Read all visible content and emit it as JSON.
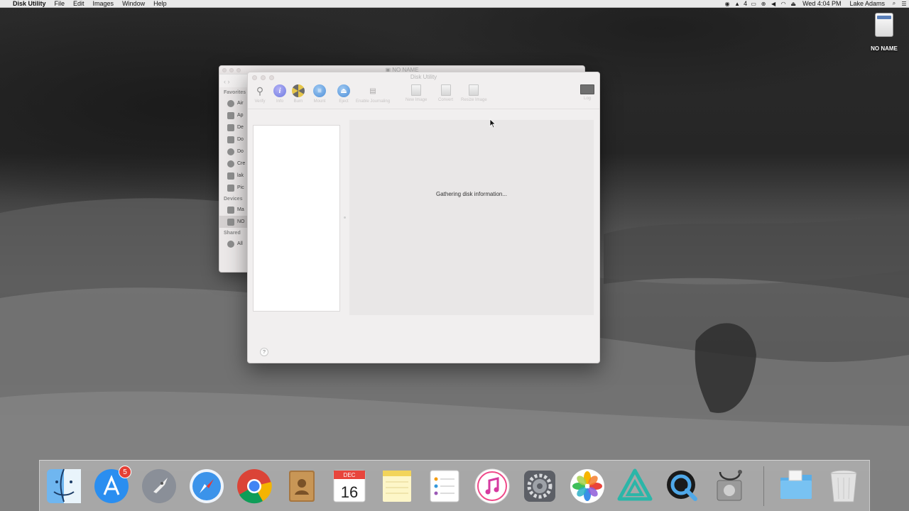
{
  "menubar": {
    "apple": "",
    "app_name": "Disk Utility",
    "menus": [
      "File",
      "Edit",
      "Images",
      "Window",
      "Help"
    ],
    "status_icons": [
      "sync-icon",
      "adobe-icon",
      "battery-status-icon",
      "link-icon",
      "volume-icon",
      "wifi-icon",
      "eject-icon"
    ],
    "adobe_count": "4",
    "clock": "Wed 4:04 PM",
    "user": "Lake Adams",
    "search_icon": "search-icon",
    "notifications_icon": "list-icon"
  },
  "desktop": {
    "drive_label": "NO NAME"
  },
  "finder_window": {
    "title": "NO NAME",
    "sidebar": {
      "favorites_header": "Favorites",
      "favorites": [
        "Air",
        "Ap",
        "De",
        "Do",
        "Do",
        "Cre",
        "lak",
        "Pic"
      ],
      "devices_header": "Devices",
      "devices": [
        "Ma",
        "NO"
      ],
      "shared_header": "Shared",
      "shared": [
        "All"
      ]
    }
  },
  "disk_utility": {
    "title": "Disk Utility",
    "toolbar": {
      "verify": "Verify",
      "info": "Info",
      "burn": "Burn",
      "mount": "Mount",
      "eject": "Eject",
      "enable_journaling": "Enable Journaling",
      "new_image": "New Image",
      "convert": "Convert",
      "resize_image": "Resize Image",
      "log": "Log"
    },
    "status_message": "Gathering disk information...",
    "help_label": "?"
  },
  "dock": {
    "items": [
      "Finder",
      "App Store",
      "Launchpad",
      "Safari",
      "Chrome",
      "Contacts",
      "Calendar",
      "Notes",
      "Reminders",
      "iTunes",
      "System Preferences",
      "Photos",
      "Affinity",
      "QuickTime Player",
      "Disk Utility",
      "Downloads",
      "Trash"
    ],
    "app_store_badge": "5",
    "calendar_month": "DEC",
    "calendar_day": "16"
  }
}
